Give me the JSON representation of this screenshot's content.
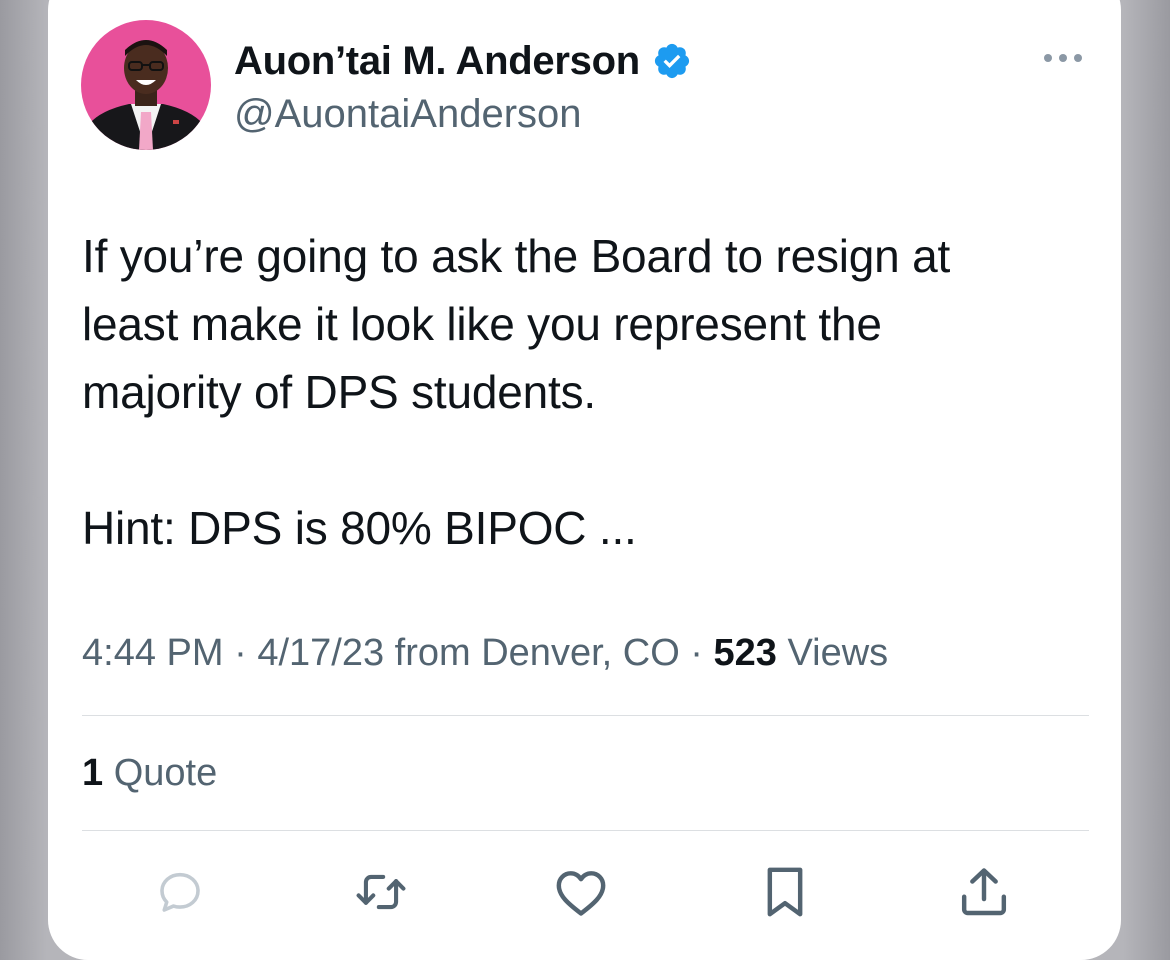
{
  "author": {
    "display_name": "Auon’tai M. Anderson",
    "handle": "@AuontaiAnderson",
    "verified": true,
    "avatar_icon": "profile-photo"
  },
  "tweet": {
    "paragraphs": [
      "If you’re going to ask the Board to resign at",
      "least make it look like you represent the",
      "majority of DPS students.",
      "Hint: DPS is 80% BIPOC ..."
    ]
  },
  "meta": {
    "time": "4:44 PM",
    "separator": " · ",
    "date": "4/17/23",
    "source": "from Denver, CO",
    "views_count": "523",
    "views_label": "Views"
  },
  "engagement": {
    "quotes_count": "1",
    "quotes_label": "Quote"
  },
  "actions": [
    {
      "name": "reply",
      "icon": "speech-bubble-icon"
    },
    {
      "name": "retweet",
      "icon": "retweet-icon"
    },
    {
      "name": "like",
      "icon": "heart-icon"
    },
    {
      "name": "bookmark",
      "icon": "bookmark-icon"
    },
    {
      "name": "share",
      "icon": "share-icon"
    }
  ],
  "colors": {
    "text_primary": "#0f1419",
    "text_secondary": "#536471",
    "verified_blue": "#1d9bf0",
    "avatar_background": "#e8509a",
    "backdrop": "#bdbdc2"
  }
}
